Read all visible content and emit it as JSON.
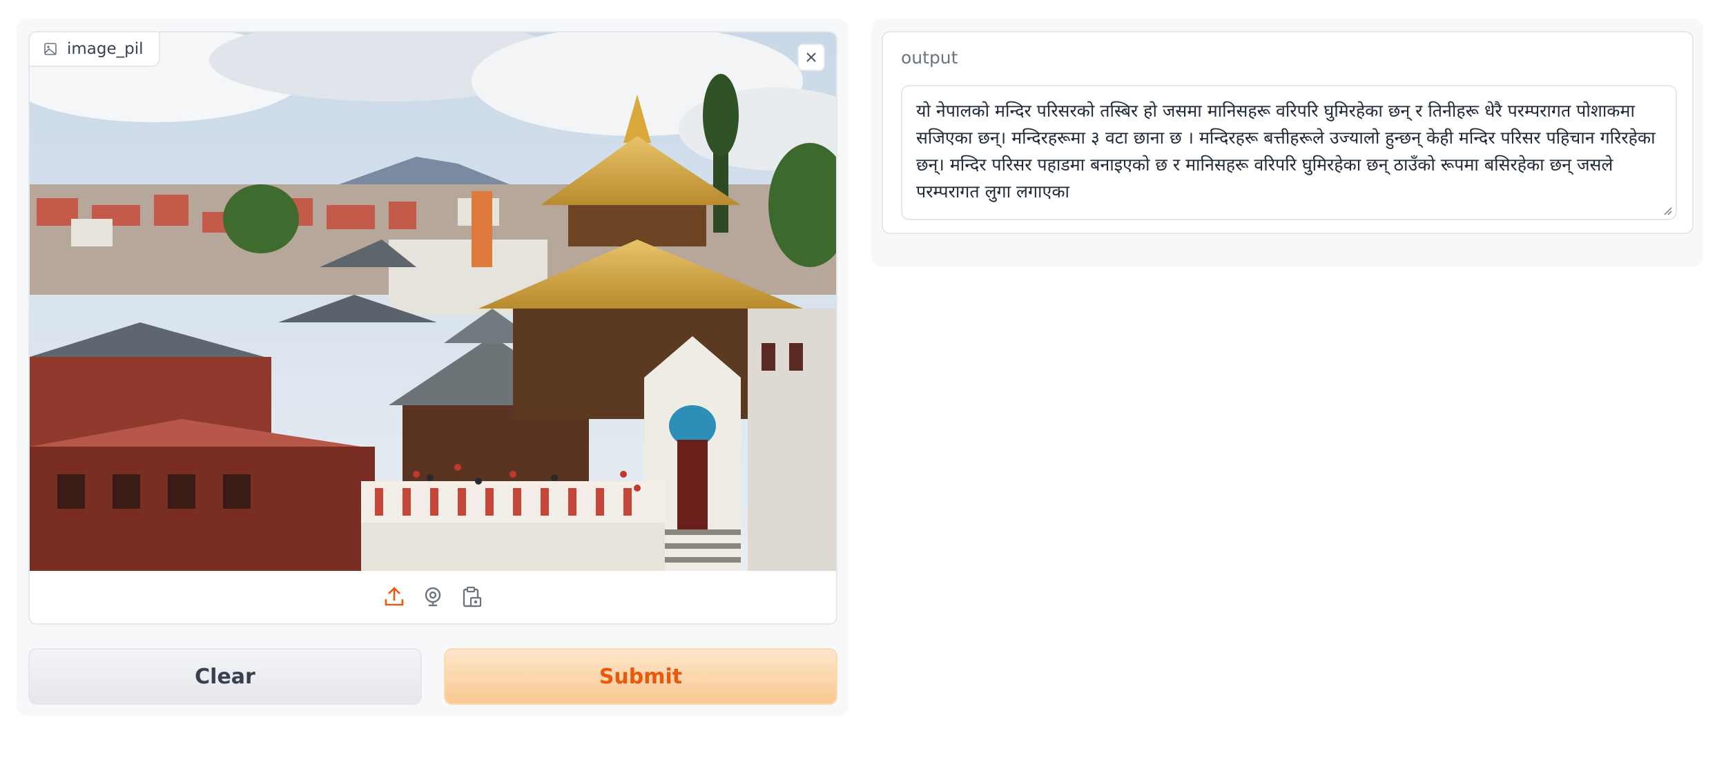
{
  "input": {
    "label": "image_pil",
    "icons": {
      "label": "image-icon",
      "close": "close-icon",
      "upload": "upload-icon",
      "webcam": "webcam-icon",
      "clipboard": "clipboard-icon"
    }
  },
  "actions": {
    "clear_label": "Clear",
    "submit_label": "Submit"
  },
  "output": {
    "label": "output",
    "text": "यो नेपालको मन्दिर परिसरको तस्बिर हो जसमा मानिसहरू वरिपरि घुमिरहेका छन् र तिनीहरू धेरै परम्परागत पोशाकमा सजिएका छन्। मन्दिरहरूमा ३ वटा छाना छ । मन्दिरहरू बत्तीहरूले उज्यालो हुन्छन् केही मन्दिर परिसर पहिचान गरिरहेका छन्। मन्दिर परिसर पहाडमा बनाइएको छ र मानिसहरू वरिपरि घुमिरहेका छन् ठाउँको रूपमा बसिरहेका छन् जसले परम्परागत लुगा लगाएका"
  },
  "colors": {
    "accent": "#ea580c",
    "submit_bg": "#f9c98f",
    "panel_bg": "#f7f8fa",
    "border": "#e5e7eb"
  }
}
